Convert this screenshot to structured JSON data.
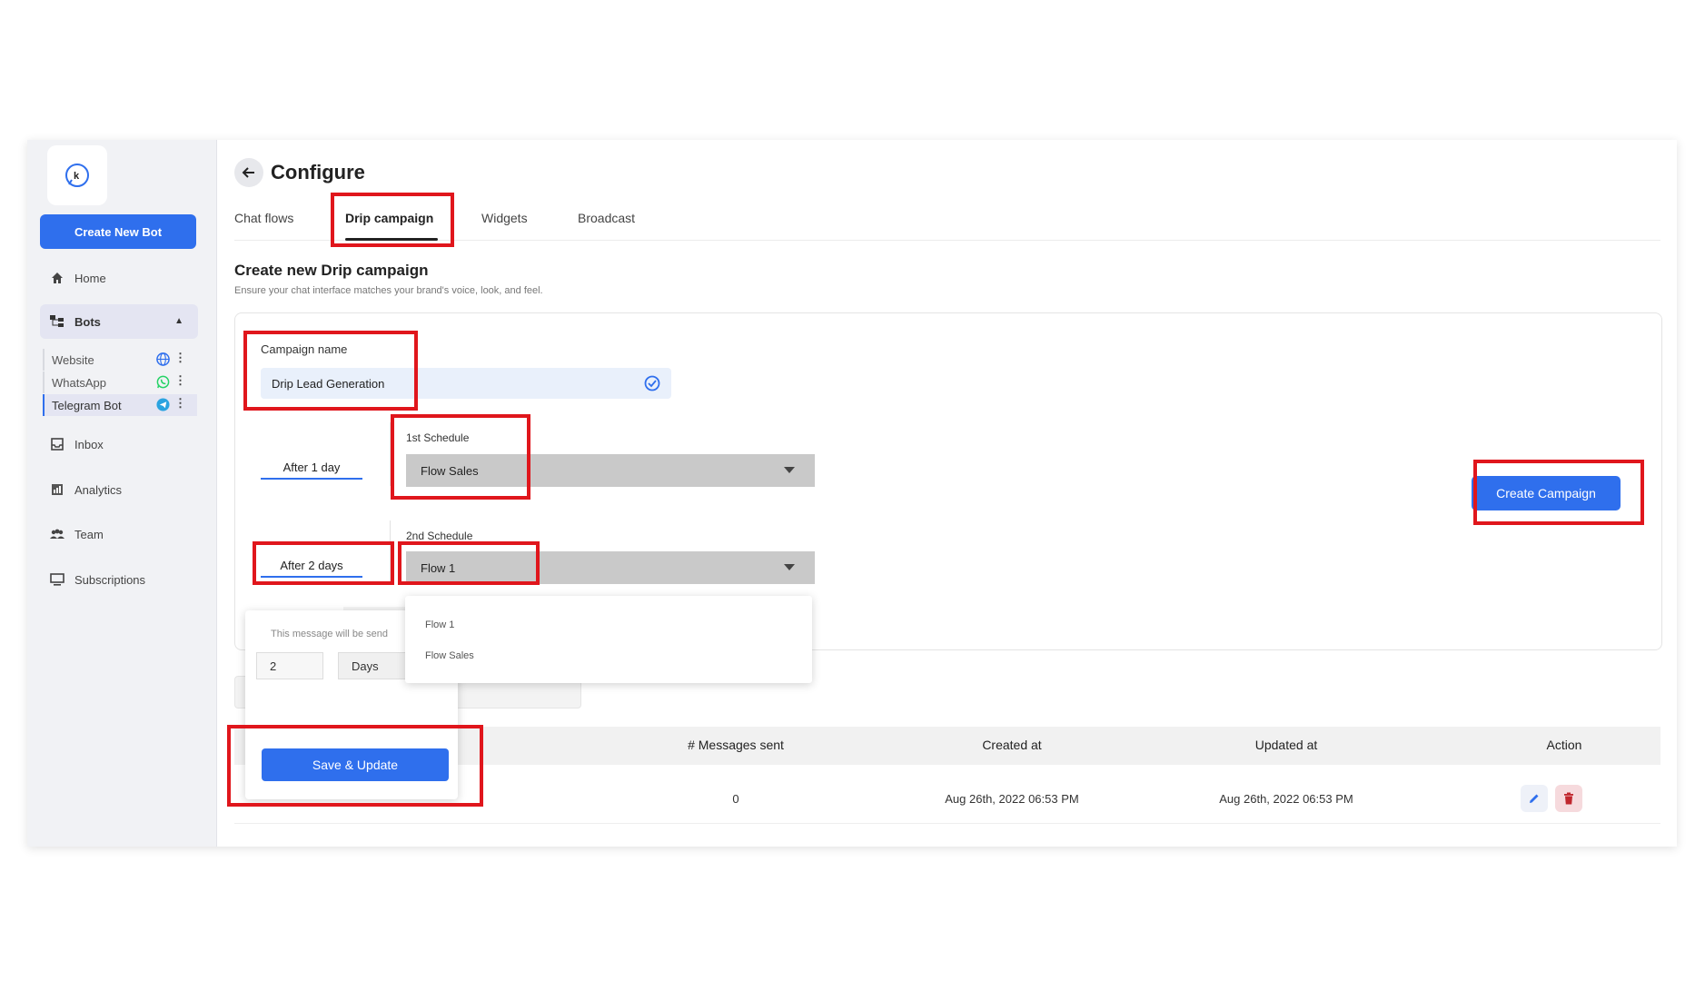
{
  "sidebar": {
    "logo_letter": "k",
    "create_bot_label": "Create New Bot",
    "nav": [
      {
        "label": "Home",
        "icon": "home-icon"
      },
      {
        "label": "Bots",
        "icon": "bots-icon"
      },
      {
        "label": "Inbox",
        "icon": "inbox-icon"
      },
      {
        "label": "Analytics",
        "icon": "analytics-icon"
      },
      {
        "label": "Team",
        "icon": "team-icon"
      },
      {
        "label": "Subscriptions",
        "icon": "subscriptions-icon"
      }
    ],
    "bots": [
      {
        "label": "Website",
        "icon": "globe-icon",
        "color": "#2f6fed"
      },
      {
        "label": "WhatsApp",
        "icon": "whatsapp-icon",
        "color": "#25d366"
      },
      {
        "label": "Telegram Bot",
        "icon": "telegram-icon",
        "color": "#2aa3e0"
      }
    ]
  },
  "header": {
    "title": "Configure",
    "tabs": [
      "Chat flows",
      "Drip campaign",
      "Widgets",
      "Broadcast"
    ],
    "active_tab": "Drip campaign"
  },
  "section": {
    "title": "Create new Drip campaign",
    "subtitle": "Ensure your chat interface matches your brand's voice, look, and feel."
  },
  "form": {
    "campaign_name_label": "Campaign name",
    "campaign_name_value": "Drip Lead Generation",
    "schedule1_after": "After 1 day",
    "schedule1_label": "1st Schedule",
    "schedule1_value": "Flow Sales",
    "schedule2_after": "After 2 days",
    "schedule2_label": "2nd Schedule",
    "schedule2_value": "Flow 1",
    "create_campaign_label": "Create Campaign"
  },
  "dropdown": {
    "options": [
      "Flow 1",
      "Flow Sales"
    ]
  },
  "popup": {
    "message_text": "This message will be send",
    "number_value": "2",
    "unit_value": "Days",
    "save_label": "Save & Update"
  },
  "table": {
    "headers": [
      "# Messages sent",
      "Created at",
      "Updated at",
      "Action"
    ],
    "rows": [
      {
        "messages_sent": "0",
        "created_at": "Aug 26th, 2022 06:53 PM",
        "updated_at": "Aug 26th, 2022 06:53 PM"
      }
    ]
  },
  "colors": {
    "accent": "#2f6fed",
    "highlight": "#e0161c",
    "delete": "#c0262d"
  }
}
